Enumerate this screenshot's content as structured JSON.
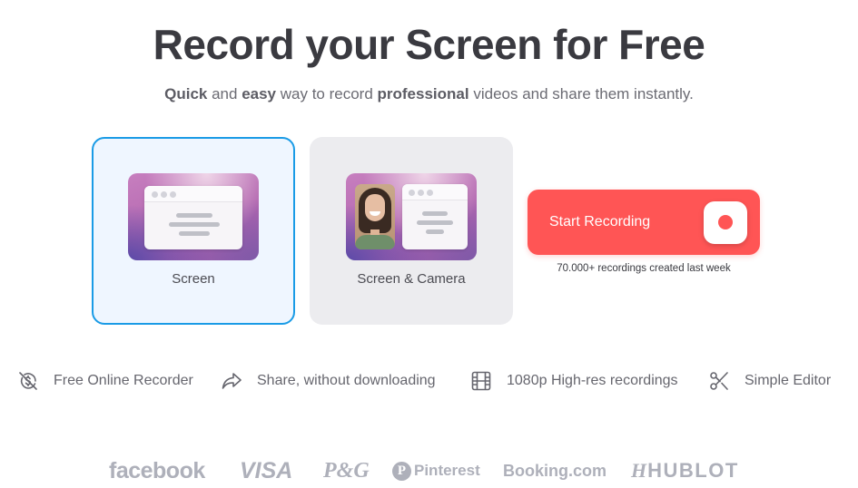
{
  "hero": {
    "title": "Record your Screen for Free",
    "subtitle_parts": [
      {
        "text": "Quick",
        "bold": true
      },
      {
        "text": " and ",
        "bold": false
      },
      {
        "text": "easy",
        "bold": true
      },
      {
        "text": " way to record ",
        "bold": false
      },
      {
        "text": "professional",
        "bold": true
      },
      {
        "text": " videos and share them instantly.",
        "bold": false
      }
    ]
  },
  "modes": [
    {
      "label": "Screen",
      "selected": true,
      "icon": "browser-window-illustration"
    },
    {
      "label": "Screen & Camera",
      "selected": false,
      "icon": "webcam-and-window-illustration"
    }
  ],
  "record": {
    "label": "Start Recording",
    "icon": "record-dot-icon",
    "note": "70.000+ recordings created last week"
  },
  "features": [
    {
      "label": "Free Online Recorder",
      "icon": "no-cost-icon"
    },
    {
      "label": "Share, without downloading",
      "icon": "share-arrow-icon"
    },
    {
      "label": "1080p High-res recordings",
      "icon": "film-strip-icon"
    },
    {
      "label": "Simple Editor",
      "icon": "scissors-icon"
    }
  ],
  "logos": {
    "facebook": "facebook",
    "visa": "VISA",
    "pg": "P&G",
    "pinterest": "Pinterest",
    "pinterest_mark": "P",
    "booking": "Booking.com",
    "hublot": "HUBLOT",
    "hublot_mark": "H"
  },
  "colors": {
    "accent_red": "#ff5555",
    "selected_border": "#1a9be6",
    "selected_bg": "#eff6ff",
    "card_bg": "#ececef",
    "logo_gray": "#aeb0ba"
  }
}
